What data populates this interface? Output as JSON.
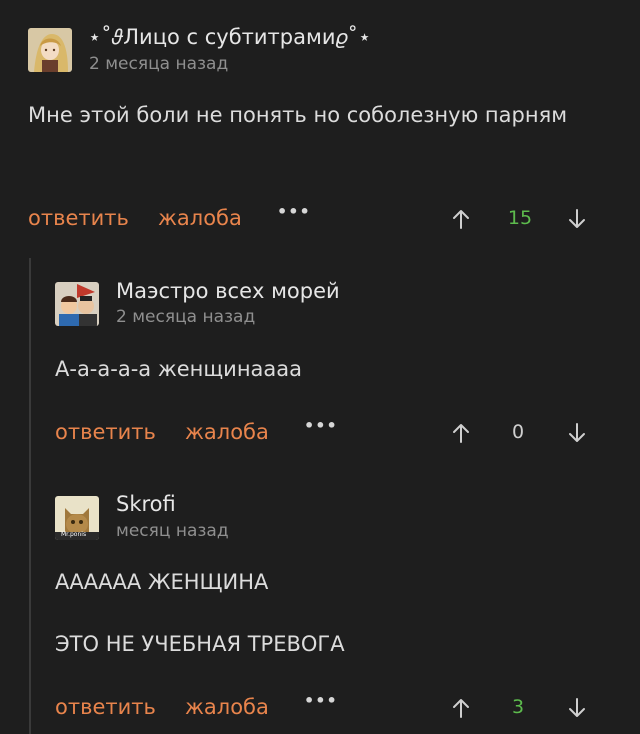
{
  "comments": [
    {
      "author": "⋆˚𝜗Лицо с субтитрами𝜚˚⋆",
      "time": "2 месяца назад",
      "text": "Мне этой боли не понять но соболезную парням",
      "reply_label": "ответить",
      "report_label": "жалоба",
      "more_label": "•••",
      "score": "15",
      "score_color": "#5dbb4d"
    },
    {
      "author": "Маэстро всех морей",
      "time": "2 месяца назад",
      "text": "А-а-а-а-а женщинаааа",
      "reply_label": "ответить",
      "report_label": "жалоба",
      "more_label": "•••",
      "score": "0",
      "score_color": "#cfcfcf"
    },
    {
      "author": "Skrofi",
      "time": "месяц назад",
      "avatar_caption": "Mr.ponis",
      "text_lines": [
        "АААААА ЖЕНЩИНА",
        "ЭТО НЕ УЧЕБНАЯ ТРЕВОГА"
      ],
      "reply_label": "ответить",
      "report_label": "жалоба",
      "more_label": "•••",
      "score": "3",
      "score_color": "#5dbb4d"
    }
  ],
  "colors": {
    "background": "#1e1e1e",
    "action_link": "#e8844c",
    "positive_score": "#5dbb4d"
  },
  "icons": {
    "upvote": "arrow-up-icon",
    "downvote": "arrow-down-icon",
    "more": "more-dots-icon"
  }
}
